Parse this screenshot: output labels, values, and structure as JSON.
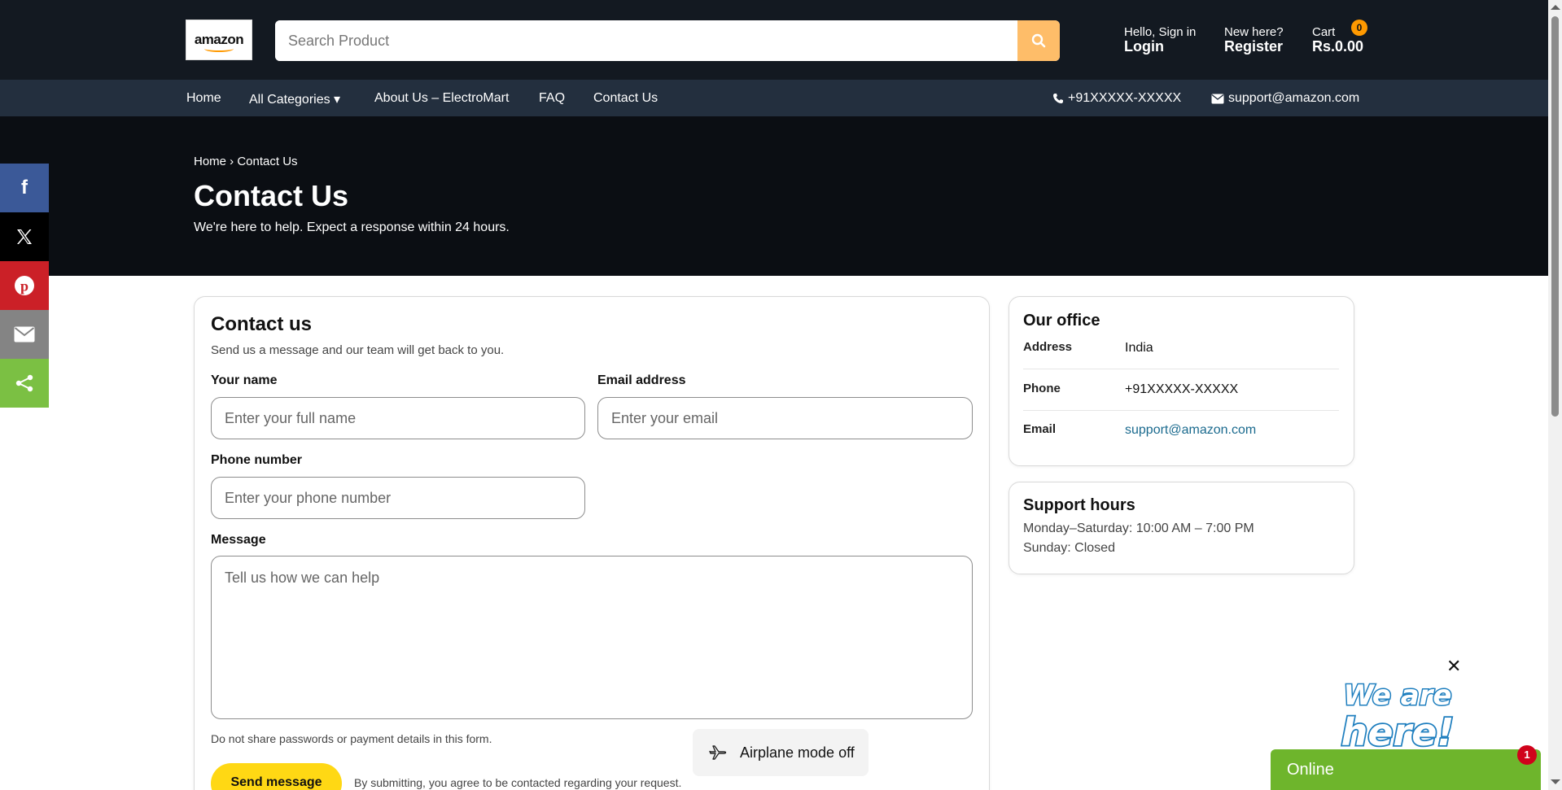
{
  "header": {
    "logo_text": "amazon",
    "search_placeholder": "Search Product",
    "signin_small": "Hello, Sign in",
    "signin_big": "Login",
    "register_small": "New here?",
    "register_big": "Register",
    "cart_small": "Cart",
    "cart_total": "Rs.0.00",
    "cart_count": "0"
  },
  "nav": {
    "items": [
      "Home",
      "All Categories ▾",
      "About Us – ElectroMart",
      "FAQ",
      "Contact Us"
    ],
    "phone": "+91XXXXX-XXXXX",
    "email": "support@amazon.com"
  },
  "hero": {
    "breadcrumb": "Home › Contact Us",
    "title": "Contact Us",
    "subtitle": "We're here to help. Expect a response within 24 hours."
  },
  "social": [
    {
      "name": "facebook",
      "color": "#3b5998"
    },
    {
      "name": "x",
      "color": "#000000"
    },
    {
      "name": "pinterest",
      "color": "#cb2027"
    },
    {
      "name": "email",
      "color": "#848484"
    },
    {
      "name": "share",
      "color": "#7bc043"
    }
  ],
  "form": {
    "title": "Contact us",
    "subtitle": "Send us a message and our team will get back to you.",
    "name_label": "Your name",
    "name_placeholder": "Enter your full name",
    "email_label": "Email address",
    "email_placeholder": "Enter your email",
    "phone_label": "Phone number",
    "phone_placeholder": "Enter your phone number",
    "message_label": "Message",
    "message_placeholder": "Tell us how we can help",
    "privacy_note": "Do not share passwords or payment details in this form.",
    "send_label": "Send message",
    "consent_note": "By submitting, you agree to be contacted regarding your request."
  },
  "office": {
    "title": "Our office",
    "rows": [
      {
        "label": "Address",
        "value": "India"
      },
      {
        "label": "Phone",
        "value": "+91XXXXX-XXXXX"
      },
      {
        "label": "Email",
        "value": "support@amazon.com"
      }
    ]
  },
  "hours": {
    "title": "Support hours",
    "weekday": "Monday–Saturday: 10:00 AM – 7:00 PM",
    "sunday": "Sunday: Closed"
  },
  "toast": {
    "text": "Airplane mode off"
  },
  "chat": {
    "art_text": "We are here!",
    "status": "Online",
    "badge": "1"
  }
}
